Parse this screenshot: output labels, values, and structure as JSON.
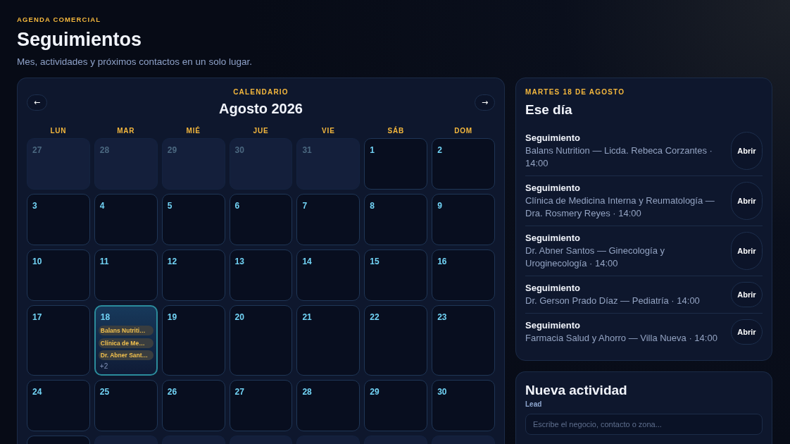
{
  "header": {
    "eyebrow": "AGENDA COMERCIAL",
    "title": "Seguimientos",
    "subtitle": "Mes, actividades y próximos contactos en un solo lugar."
  },
  "calendar": {
    "eyebrow": "CALENDARIO",
    "title": "Agosto 2026",
    "prev_button": "←",
    "next_button": "→",
    "weekdays": [
      "LUN",
      "MAR",
      "MIÉ",
      "JUE",
      "VIE",
      "SÁB",
      "DOM"
    ],
    "weeks": [
      [
        {
          "day": "27",
          "in_month": false,
          "selected": false
        },
        {
          "day": "28",
          "in_month": false,
          "selected": false
        },
        {
          "day": "29",
          "in_month": false,
          "selected": false
        },
        {
          "day": "30",
          "in_month": false,
          "selected": false
        },
        {
          "day": "31",
          "in_month": false,
          "selected": false
        },
        {
          "day": "1",
          "in_month": true,
          "selected": false
        },
        {
          "day": "2",
          "in_month": true,
          "selected": false
        }
      ],
      [
        {
          "day": "3",
          "in_month": true,
          "selected": false
        },
        {
          "day": "4",
          "in_month": true,
          "selected": false
        },
        {
          "day": "5",
          "in_month": true,
          "selected": false
        },
        {
          "day": "6",
          "in_month": true,
          "selected": false
        },
        {
          "day": "7",
          "in_month": true,
          "selected": false
        },
        {
          "day": "8",
          "in_month": true,
          "selected": false
        },
        {
          "day": "9",
          "in_month": true,
          "selected": false
        }
      ],
      [
        {
          "day": "10",
          "in_month": true,
          "selected": false
        },
        {
          "day": "11",
          "in_month": true,
          "selected": false
        },
        {
          "day": "12",
          "in_month": true,
          "selected": false
        },
        {
          "day": "13",
          "in_month": true,
          "selected": false
        },
        {
          "day": "14",
          "in_month": true,
          "selected": false
        },
        {
          "day": "15",
          "in_month": true,
          "selected": false
        },
        {
          "day": "16",
          "in_month": true,
          "selected": false
        }
      ],
      [
        {
          "day": "17",
          "in_month": true,
          "selected": false
        },
        {
          "day": "18",
          "in_month": true,
          "selected": true,
          "events": [
            "Balans Nutriti…",
            "Clínica de Me…",
            "Dr. Abner Sant…"
          ],
          "more": "+2"
        },
        {
          "day": "19",
          "in_month": true,
          "selected": false
        },
        {
          "day": "20",
          "in_month": true,
          "selected": false
        },
        {
          "day": "21",
          "in_month": true,
          "selected": false
        },
        {
          "day": "22",
          "in_month": true,
          "selected": false
        },
        {
          "day": "23",
          "in_month": true,
          "selected": false
        }
      ],
      [
        {
          "day": "24",
          "in_month": true,
          "selected": false
        },
        {
          "day": "25",
          "in_month": true,
          "selected": false
        },
        {
          "day": "26",
          "in_month": true,
          "selected": false
        },
        {
          "day": "27",
          "in_month": true,
          "selected": false
        },
        {
          "day": "28",
          "in_month": true,
          "selected": false
        },
        {
          "day": "29",
          "in_month": true,
          "selected": false
        },
        {
          "day": "30",
          "in_month": true,
          "selected": false
        }
      ],
      [
        {
          "in_month": true,
          "selected": false
        },
        {
          "in_month": false,
          "selected": false
        },
        {
          "in_month": false,
          "selected": false
        },
        {
          "in_month": false,
          "selected": false
        },
        {
          "in_month": false,
          "selected": false
        },
        {
          "in_month": false,
          "selected": false
        },
        {
          "in_month": false,
          "selected": false
        }
      ]
    ]
  },
  "day_panel": {
    "eyebrow": "MARTES 18 DE AGOSTO",
    "title": "Ese día",
    "items": [
      {
        "title": "Seguimiento",
        "detail": "Balans Nutrition — Licda. Rebeca Corzantes · 14:00",
        "button": "Abrir"
      },
      {
        "title": "Seguimiento",
        "detail": "Clínica de Medicina Interna y Reumatología — Dra. Rosmery Reyes · 14:00",
        "button": "Abrir"
      },
      {
        "title": "Seguimiento",
        "detail": "Dr. Abner Santos — Ginecología y Uroginecología · 14:00",
        "button": "Abrir"
      },
      {
        "title": "Seguimiento",
        "detail": "Dr. Gerson Prado Díaz — Pediatría · 14:00",
        "button": "Abrir"
      },
      {
        "title": "Seguimiento",
        "detail": "Farmacia Salud y Ahorro — Villa Nueva · 14:00",
        "button": "Abrir"
      }
    ]
  },
  "activity_panel": {
    "title": "Nueva actividad",
    "fields": [
      {
        "label": "Lead",
        "placeholder": "Escribe el negocio, contacto o zona..."
      }
    ]
  }
}
